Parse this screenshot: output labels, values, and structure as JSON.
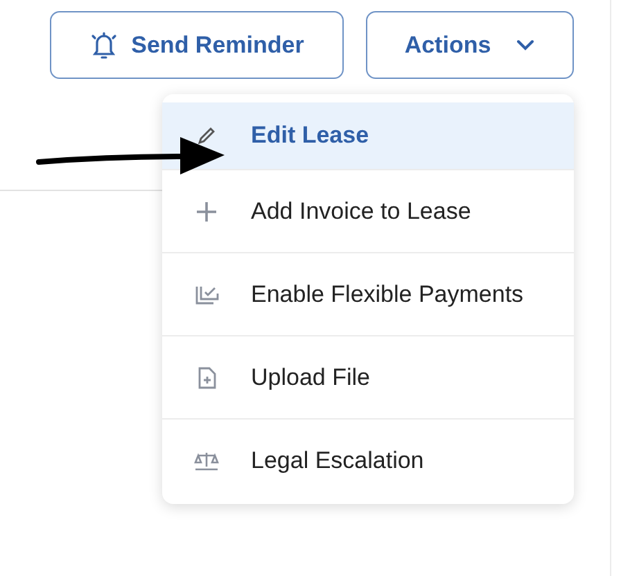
{
  "buttons": [
    {
      "label": "Send Reminder",
      "kind": "reminder"
    },
    {
      "label": "Actions",
      "kind": "dropdown",
      "expanded": true
    }
  ],
  "menu": {
    "items": [
      {
        "label": "Edit Lease",
        "kind": "edit",
        "selected": true
      },
      {
        "label": "Add Invoice to Lease",
        "kind": "add",
        "selected": false
      },
      {
        "label": "Enable Flexible Payments",
        "kind": "enable",
        "selected": false
      },
      {
        "label": "Upload File",
        "kind": "upload",
        "selected": false
      },
      {
        "label": "Legal Escalation",
        "kind": "legal",
        "selected": false
      }
    ]
  }
}
